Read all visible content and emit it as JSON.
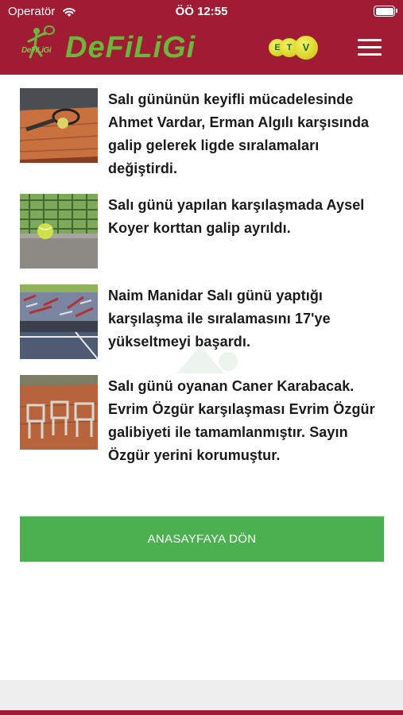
{
  "status_bar": {
    "carrier": "Operatör",
    "time": "ÖÖ 12:55",
    "icons": [
      "wifi-icon",
      "battery-icon"
    ]
  },
  "header": {
    "logo_text": "DeFiLiGi",
    "emblem_text": "DeFiLiGi",
    "partner_logo": [
      "E",
      "T",
      "V"
    ],
    "menu_icon": "hamburger-menu-icon",
    "background_color": "#a01c32",
    "logo_color": "#6ab73c"
  },
  "news": [
    {
      "thumbnail": "tennis-racket-on-clay-court-image",
      "text": "Salı gününün keyifli mücadelesinde Ahmet Vardar, Erman Algılı karşısında galip gelerek ligde sıralamaları değiştirdi."
    },
    {
      "thumbnail": "tennis-ball-by-fence-image",
      "text": "Salı günü yapılan karşılaşmada Aysel Koyer korttan galip ayrıldı."
    },
    {
      "thumbnail": "davis-cup-court-image",
      "text": "Naim Manidar Salı günü yaptığı karşılaşma ile sıralamasını 17'ye yükseltmeyi başardı."
    },
    {
      "thumbnail": "chairs-on-clay-court-image",
      "text": "Salı günü oyanan Caner Karabacak. Evrim Özgür karşılaşması Evrim Özgür galibiyeti ile tamamlanmıştır. Sayın Özgür yerini korumuştur."
    }
  ],
  "home_button": {
    "label": "ANASAYFAYA DÖN",
    "color": "#4caf50"
  }
}
